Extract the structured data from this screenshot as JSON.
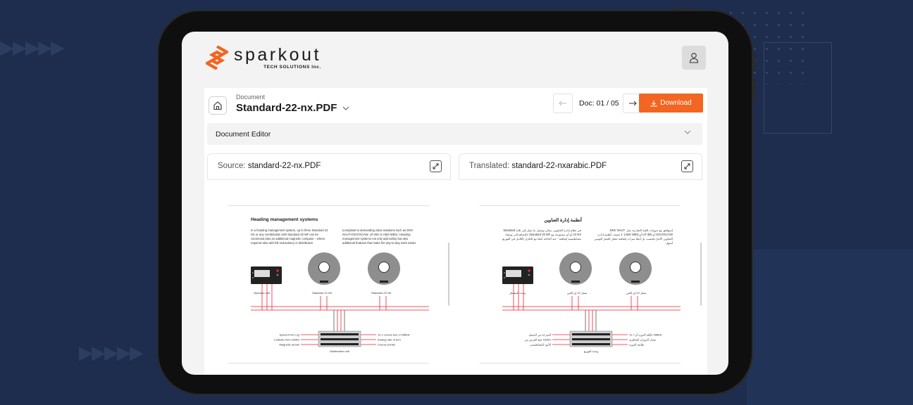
{
  "brand": {
    "name": "sparkout",
    "sub": "TECH SOLUTIONS Inc.",
    "accent_color": "#f26522"
  },
  "header": {
    "user_icon": "user-icon"
  },
  "document": {
    "label": "Document",
    "filename": "Standard-22-nx.PDF",
    "counter": "Doc: 01 / 05",
    "download_label": "Download"
  },
  "editor": {
    "label": "Document Editor"
  },
  "source_pane": {
    "prefix": "Source:",
    "filename": "standard-22-nx.PDF"
  },
  "translated_pane": {
    "prefix": "Translated:",
    "filename": "standard-22-nxarabic.PDF"
  },
  "source_page": {
    "heading": "Heading management systems",
    "col1": "In a heading management system, up to three Standard 22 NX or any combination with Standard 30 MF can be connected plus an additional magnetic compass – where required also with full redundancy in distribution",
    "col2": "(compliant to demanding class notations such as DNV NAUT-OSV/OC/AW, LR IBS or ABS NIBS). Heading management systems not only add safety but also additional features that make the day-to-day work easier.",
    "labels": {
      "operator": "Operator unit",
      "gyro1": "Standard 22 NX",
      "gyro2": "Standard 22 NX",
      "in1": "Speed from Log",
      "in2": "Latitude from GNSS",
      "in3": "Magnetic anode",
      "out1": "12 x course bus or NMEA",
      "out2": "Analog rate of turn",
      "out3": "Course printer",
      "dist": "Distribution unit"
    }
  },
  "translated_page": {
    "heading": "أنظمة إدارة العناوين",
    "col1": "في نظام إدارة العناوين، يمكن توصيل ما يصل إلى ثلاثة Standard 22 NX أو أي مجموعة مع Standard 30 MF بالإضافة إلى بوصلة مغناطيسية إضافية - عند الحاجة أيضًا مع التكرار الكامل في التوزيع",
    "col2": "(متوافق مع تدوينات الفئة الصارمة مثل DNV NAUT-OSV/OC/AW أو LR IBS أو ABS NIBS). لا تضيف أنظمة إدارة العناوين الأمان فحسب بل أيضًا ميزات إضافية تجعل العمل اليومي أسهل.",
    "labels": {
      "operator": "وحدة المشغل",
      "gyro1": "معيار 22 إن إكس",
      "gyro2": "معيار 22 إن إكس",
      "in1": "السرعة من السجل",
      "in2": "خط العرض من GNSS",
      "in3": "الأنود المغناطيسي",
      "out1": "12 × حافلة الدورة أو NMEA",
      "out2": "معدل الدوران التناظري",
      "out3": "طابعة الدورة",
      "dist": "وحدة التوزيع"
    }
  }
}
